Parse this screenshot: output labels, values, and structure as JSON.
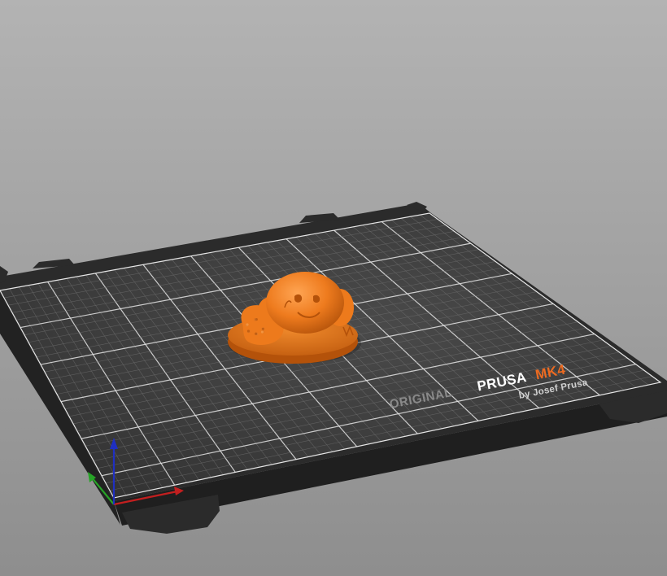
{
  "viewport": {
    "background_top": "#b3b3b3",
    "background_bottom": "#8e8e8e"
  },
  "bed": {
    "frame_color": "#2b2b2b",
    "frame_edge_color": "#3a3a3a",
    "sheet_color": "#3d3d3d",
    "grid_minor_color": "#6e6e6e",
    "grid_major_color": "#e6e6e6",
    "logo": {
      "word1": "ORIGINAL",
      "word2": "PRUSA",
      "word3": "MK4",
      "byline": "by Josef Prusa",
      "word1_color": "#8a8a8a",
      "word2_color": "#ffffff",
      "word3_color": "#ed6b21",
      "byline_color": "#d0d0d0"
    }
  },
  "model": {
    "name": "orange figurine",
    "color": "#ed7a1c",
    "shade_color": "#b4520a",
    "highlight_color": "#ffa04a"
  },
  "axes": {
    "x_color": "#c21f1f",
    "y_color": "#27a327",
    "z_color": "#1f2fc2"
  }
}
